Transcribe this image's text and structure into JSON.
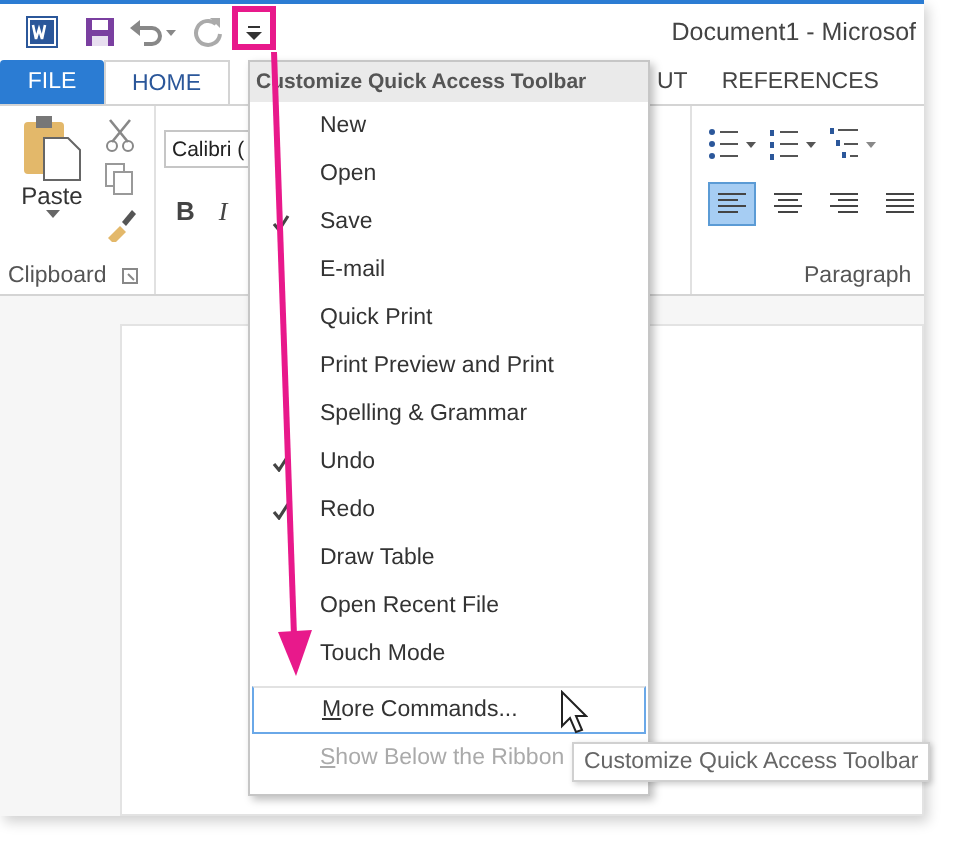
{
  "window": {
    "title": "Document1 - Microsof"
  },
  "tabs": [
    {
      "label": "FILE",
      "kind": "file",
      "selected": false
    },
    {
      "label": "HOME",
      "kind": "tab",
      "selected": true
    },
    {
      "label": "UT",
      "kind": "tab",
      "selected": false
    },
    {
      "label": "REFERENCES",
      "kind": "tab",
      "selected": false
    }
  ],
  "ribbon": {
    "paste_label": "Paste",
    "font_box": {
      "value": "Calibri ("
    },
    "bold": "B",
    "italic": "I",
    "groups": [
      {
        "label": "Clipboard"
      },
      {
        "label": "Paragraph"
      }
    ],
    "alignments": [
      {
        "selected": true
      },
      {
        "selected": false
      },
      {
        "selected": false
      },
      {
        "selected": false
      }
    ]
  },
  "menu": {
    "title": "Customize Quick Access Toolbar",
    "items": [
      {
        "label": "New",
        "kind": "toggle",
        "checked": false,
        "highlighted": false,
        "disabled": false
      },
      {
        "label": "Open",
        "kind": "toggle",
        "checked": false,
        "highlighted": false,
        "disabled": false
      },
      {
        "label": "Save",
        "kind": "toggle",
        "checked": true,
        "highlighted": false,
        "disabled": false
      },
      {
        "label": "E-mail",
        "kind": "toggle",
        "checked": false,
        "highlighted": false,
        "disabled": false
      },
      {
        "label": "Quick Print",
        "kind": "toggle",
        "checked": false,
        "highlighted": false,
        "disabled": false
      },
      {
        "label": "Print Preview and Print",
        "kind": "toggle",
        "checked": false,
        "highlighted": false,
        "disabled": false
      },
      {
        "label": "Spelling & Grammar",
        "kind": "toggle",
        "checked": false,
        "highlighted": false,
        "disabled": false
      },
      {
        "label": "Undo",
        "kind": "toggle",
        "checked": true,
        "highlighted": false,
        "disabled": false
      },
      {
        "label": "Redo",
        "kind": "toggle",
        "checked": true,
        "highlighted": false,
        "disabled": false
      },
      {
        "label": "Draw Table",
        "kind": "toggle",
        "checked": false,
        "highlighted": false,
        "disabled": false
      },
      {
        "label": "Open Recent File",
        "kind": "toggle",
        "checked": false,
        "highlighted": false,
        "disabled": false
      },
      {
        "label": "Touch Mode",
        "kind": "toggle",
        "checked": false,
        "highlighted": false,
        "disabled": false
      },
      {
        "label": "More Commands...",
        "kind": "command",
        "checked": false,
        "highlighted": true,
        "disabled": false
      },
      {
        "label": "Show Below the Ribbon",
        "kind": "command",
        "checked": false,
        "highlighted": false,
        "disabled": true
      }
    ]
  },
  "tooltip": {
    "text": "Customize Quick Access Toolbar"
  }
}
